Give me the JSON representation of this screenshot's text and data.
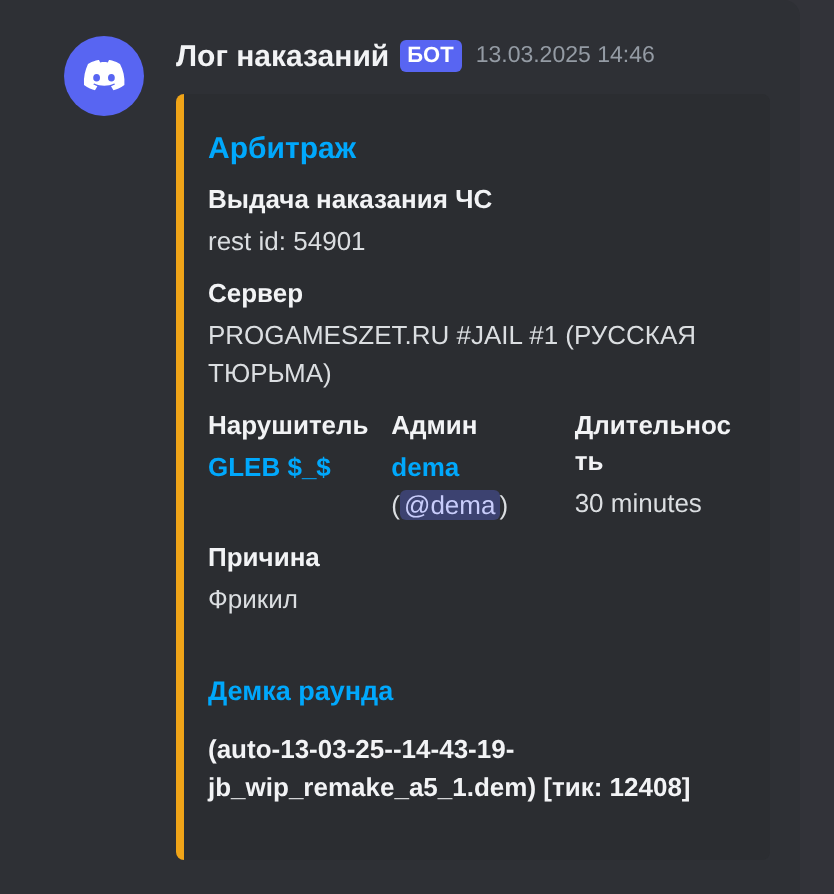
{
  "message": {
    "author": "Лог наказаний",
    "badge": "БОТ",
    "timestamp": "13.03.2025 14:46"
  },
  "embed": {
    "title": "Арбитраж",
    "fields": [
      {
        "name": "Выдача наказания ЧС",
        "name_link": false,
        "inline": false,
        "kind": "text",
        "value": "rest id: 54901"
      },
      {
        "name": "Сервер",
        "name_link": false,
        "inline": false,
        "kind": "text",
        "value": "PROGAMESZET.RU #JAIL #1 (РУССКАЯ ТЮРЬМА)"
      },
      {
        "name": "Нарушитель",
        "name_link": false,
        "inline": true,
        "kind": "link",
        "value": "GLEB $_$"
      },
      {
        "name": "Админ",
        "name_link": false,
        "inline": true,
        "kind": "user",
        "value": "dema",
        "pre": "(",
        "mention": "@dema",
        "post": ")"
      },
      {
        "name": "Длительность",
        "name_link": false,
        "inline": true,
        "kind": "text",
        "value": "30 minutes"
      },
      {
        "name": "Причина",
        "name_link": false,
        "inline": false,
        "kind": "text",
        "value": "Фрикил"
      },
      {
        "name": "Демка раунда",
        "name_link": true,
        "inline": false,
        "kind": "bold",
        "value": "(auto-13-03-25--14-43-19-jb_wip_remake_a5_1.dem) [тик: 12408]"
      }
    ]
  }
}
